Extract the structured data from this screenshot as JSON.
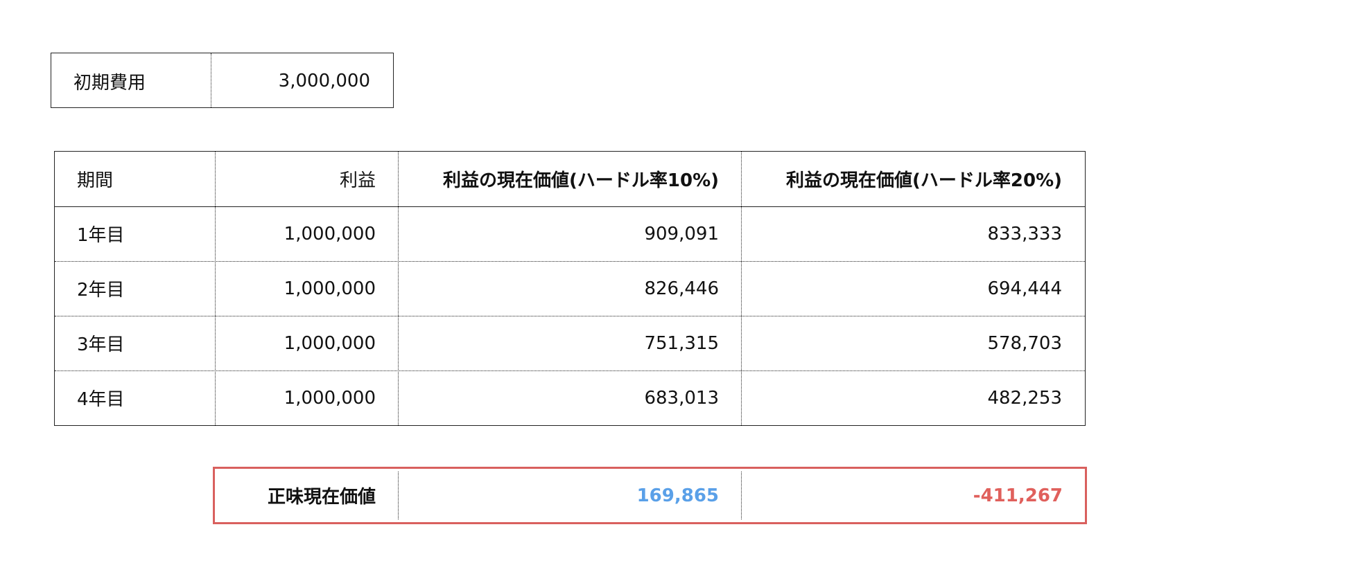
{
  "initial_cost": {
    "label": "初期費用",
    "value": "3,000,000"
  },
  "table": {
    "headers": [
      "期間",
      "利益",
      "利益の現在価値(ハードル率10%)",
      "利益の現在価値(ハードル率20%)"
    ],
    "rows": [
      [
        "1年目",
        "1,000,000",
        "909,091",
        "833,333"
      ],
      [
        "2年目",
        "1,000,000",
        "826,446",
        "694,444"
      ],
      [
        "3年目",
        "1,000,000",
        "751,315",
        "578,703"
      ],
      [
        "4年目",
        "1,000,000",
        "683,013",
        "482,253"
      ]
    ]
  },
  "summary": {
    "label": "正味現在価値",
    "npv_10": "169,865",
    "npv_20": "-411,267",
    "colors": {
      "positive": "#5aa0e8",
      "negative": "#e0605c",
      "frame": "#d9605e"
    }
  }
}
